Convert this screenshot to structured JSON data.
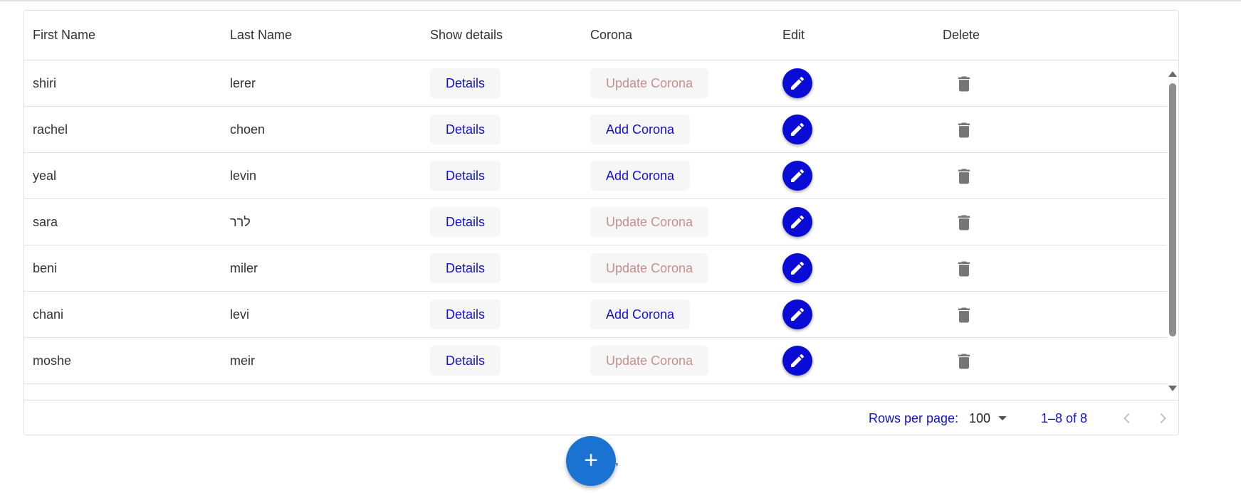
{
  "columns": [
    "First Name",
    "Last Name",
    "Show details",
    "Corona",
    "Edit",
    "Delete"
  ],
  "rows": [
    {
      "first": "shiri",
      "last": "lerer",
      "details": "Details",
      "corona": "Update Corona",
      "corona_kind": "update"
    },
    {
      "first": "rachel",
      "last": "choen",
      "details": "Details",
      "corona": "Add Corona",
      "corona_kind": "add"
    },
    {
      "first": "yeal",
      "last": "levin",
      "details": "Details",
      "corona": "Add Corona",
      "corona_kind": "add"
    },
    {
      "first": "sara",
      "last": "לרר",
      "details": "Details",
      "corona": "Update Corona",
      "corona_kind": "update"
    },
    {
      "first": "beni",
      "last": "miler",
      "details": "Details",
      "corona": "Update Corona",
      "corona_kind": "update"
    },
    {
      "first": "chani",
      "last": "levi",
      "details": "Details",
      "corona": "Add Corona",
      "corona_kind": "add"
    },
    {
      "first": "moshe",
      "last": "meir",
      "details": "Details",
      "corona": "Update Corona",
      "corona_kind": "update"
    },
    {
      "first": "",
      "last": "",
      "details": "",
      "corona": "",
      "corona_kind": "hidden"
    }
  ],
  "icons": {
    "edit": "pencil-icon",
    "delete": "trash-icon",
    "add": "plus-icon",
    "prev": "chevron-left-icon",
    "next": "chevron-right-icon"
  },
  "pagination": {
    "rows_label": "Rows per page:",
    "rows_value": "100",
    "range": "1–8 of 8"
  },
  "fab": {
    "label": "+",
    "trailing": ","
  },
  "colors": {
    "link_blue": "#1111cc",
    "edit_blue": "#0b0bd6",
    "fab_blue": "#1a73d2",
    "update_text": "#c4908f"
  }
}
